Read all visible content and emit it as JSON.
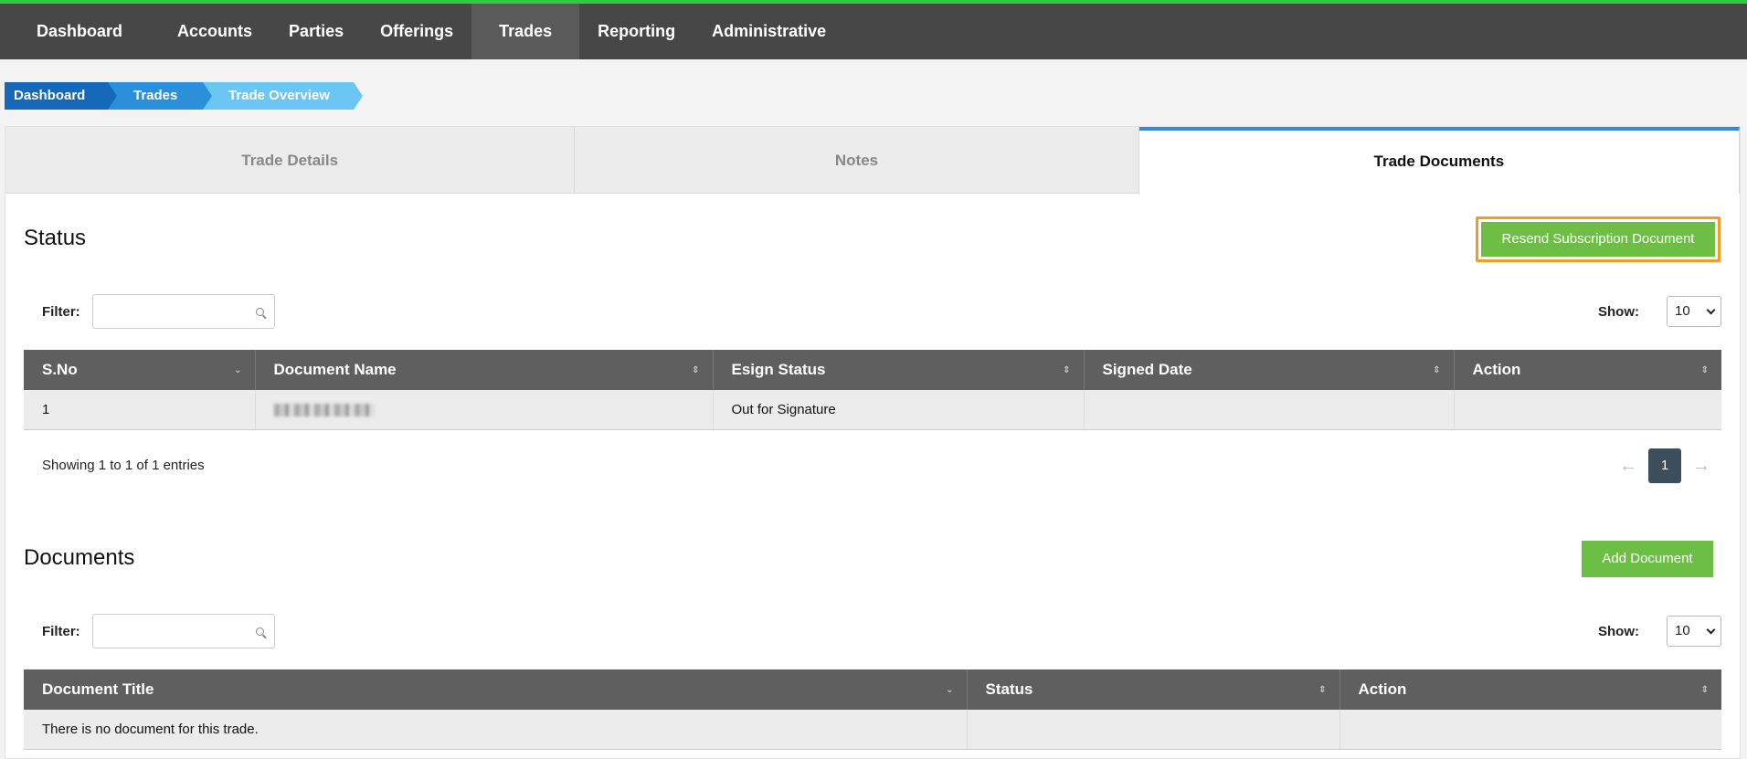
{
  "nav": {
    "items": [
      "Dashboard",
      "Accounts",
      "Parties",
      "Offerings",
      "Trades",
      "Reporting",
      "Administrative"
    ],
    "active": "Trades"
  },
  "breadcrumb": [
    "Dashboard",
    "Trades",
    "Trade Overview"
  ],
  "tabs": [
    "Trade Details",
    "Notes",
    "Trade Documents"
  ],
  "active_tab": "Trade Documents",
  "status_section": {
    "title": "Status",
    "resend_button": "Resend Subscription Document",
    "filter_label": "Filter:",
    "filter_value": "",
    "show_label": "Show:",
    "show_value": "10",
    "columns": [
      "S.No",
      "Document Name",
      "Esign Status",
      "Signed Date",
      "Action"
    ],
    "rows": [
      {
        "sno": "1",
        "document_name": "",
        "esign_status": "Out for Signature",
        "signed_date": "",
        "action": ""
      }
    ],
    "showing_text": "Showing 1 to 1 of 1 entries",
    "prev_arrow": "←",
    "next_arrow": "→",
    "current_page": "1"
  },
  "documents_section": {
    "title": "Documents",
    "add_button": "Add Document",
    "filter_label": "Filter:",
    "filter_value": "",
    "show_label": "Show:",
    "show_value": "10",
    "columns": [
      "Document Title",
      "Status",
      "Action"
    ],
    "empty_text": "There is no document for this trade."
  },
  "colors": {
    "nav_bg": "#474747",
    "nav_accent": "#2ecc40",
    "green_button": "#6cbf44",
    "highlight_outline": "#f39a2b",
    "active_tab_border": "#2d8ee0",
    "table_header": "#5f5f5f",
    "pager_active": "#3c4e5c"
  }
}
